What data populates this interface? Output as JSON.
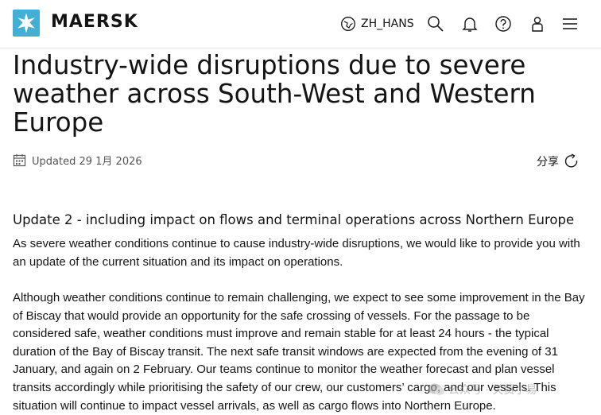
{
  "header": {
    "brand": "MAERSK",
    "language": "ZH_HANS",
    "icons": [
      "globe-icon",
      "search-icon",
      "bell-icon",
      "help-icon",
      "user-icon",
      "menu-icon"
    ],
    "accent": "#42b0d5"
  },
  "article": {
    "title": "Industry-wide disruptions due to severe weather across South-West and Western Europe",
    "updated": "Updated 29 1月 2026",
    "share": "分享",
    "subtitle": "Update 2 - including impact on flows and terminal operations across Northern Europe",
    "paragraphs": [
      "As severe weather conditions continue to cause industry-wide disruptions, we would like to provide you with an update of the current situation and its impact on operations.",
      "Although weather conditions continue to remain challenging, we expect to see some improvement in the Bay of Biscay that would provide an opportunity for the safe crossing of vessels. For the passage to be considered safe, weather conditions must improve and remain stable for at least 24 hours - the typical duration of the Bay of Biscay transit. The next safe transit windows are expected from the evening of 31 January, and again on 2 February. Our teams continue to monitor the weather forecast and plan vessel transits accordingly while prioritising the safety of our crew, our customers’ cargo, and our vessels. This situation will continue to impact vessel arrivals, as well as cargo flows into Northern Europe."
    ]
  },
  "watermark": "公众号 · 关贸小易"
}
